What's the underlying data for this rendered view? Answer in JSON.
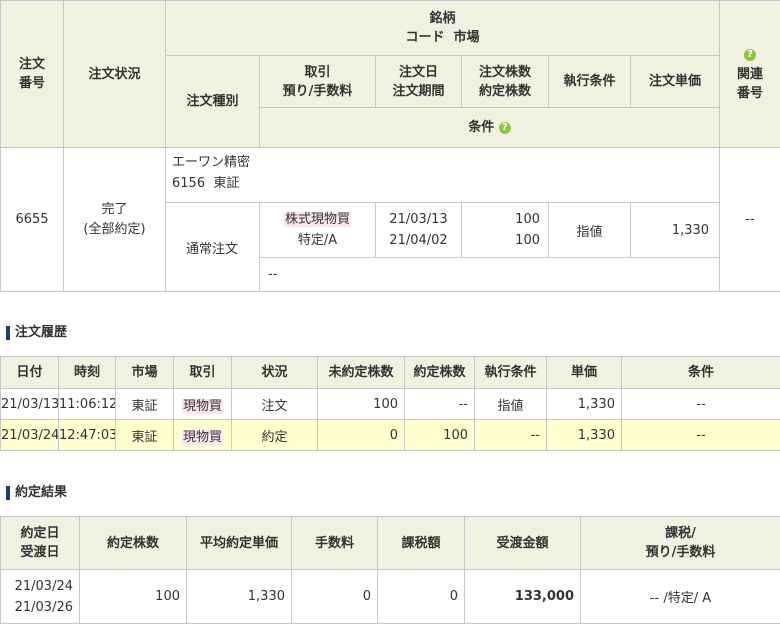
{
  "order_header": {
    "order_no": "注文\n番号",
    "status": "注文状況",
    "issue": "銘柄",
    "code_market": "コード  市場",
    "order_type": "注文種別",
    "trade": "取引\n預り/手数料",
    "order_date": "注文日\n注文期間",
    "qty": "注文株数\n約定株数",
    "exec_cond": "執行条件",
    "price": "注文単価",
    "related": "関連\n番号",
    "condition": "条件",
    "help_icon": "?"
  },
  "order": {
    "order_no": "6655",
    "status": "完了\n(全部約定)",
    "issue_name": "エーワン精密",
    "code_market": "6156  東証",
    "order_type": "通常注文",
    "trade_tag": "株式現物買",
    "account": "特定/A",
    "order_date": "21/03/13",
    "order_period": "21/04/02",
    "order_qty": "100",
    "exec_qty": "100",
    "exec_cond": "指値",
    "price": "1,330",
    "related": "--",
    "condition": "--"
  },
  "history": {
    "title": "注文履歴",
    "headers": [
      "日付",
      "時刻",
      "市場",
      "取引",
      "状況",
      "未約定株数",
      "約定株数",
      "執行条件",
      "単価",
      "条件"
    ],
    "rows": [
      {
        "date": "21/03/13",
        "time": "11:06:12",
        "market": "東証",
        "trade": "現物買",
        "status": "注文",
        "unexec": "100",
        "exec": "--",
        "cond": "指値",
        "price": "1,330",
        "condition": "--"
      },
      {
        "date": "21/03/24",
        "time": "12:47:03",
        "market": "東証",
        "trade": "現物買",
        "status": "約定",
        "unexec": "0",
        "exec": "100",
        "cond": "--",
        "price": "1,330",
        "condition": "--"
      }
    ]
  },
  "result": {
    "title": "約定結果",
    "headers": [
      "約定日\n受渡日",
      "約定株数",
      "平均約定単価",
      "手数料",
      "課税額",
      "受渡金額",
      "課税/\n預り/手数料"
    ],
    "row": {
      "exec_date": "21/03/24",
      "delivery_date": "21/03/26",
      "qty": "100",
      "avg_price": "1,330",
      "fee": "0",
      "tax": "0",
      "amount": "133,000",
      "account": "-- /特定/ A"
    }
  },
  "colors": {
    "header_bg": "#f1f1e1",
    "highlight_row": "#ffffd0",
    "tag_bg": "#fde5ec",
    "help_icon": "#8cc63f",
    "section_bar": "#1d3b7a"
  }
}
